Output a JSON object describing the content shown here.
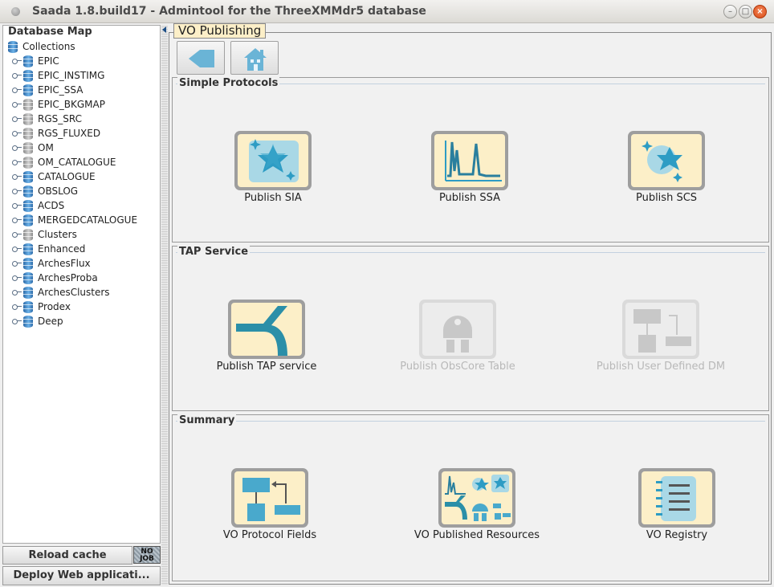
{
  "window": {
    "title": "Saada 1.8.build17 - Admintool for the ThreeXMMdr5 database",
    "buttons": {
      "minimize": "–",
      "maximize": "□",
      "close": "×"
    }
  },
  "sidebar": {
    "header": "Database Map",
    "root": "Collections",
    "items": [
      {
        "label": "EPIC",
        "color": "blue"
      },
      {
        "label": "EPIC_INSTIMG",
        "color": "blue"
      },
      {
        "label": "EPIC_SSA",
        "color": "blue"
      },
      {
        "label": "EPIC_BKGMAP",
        "color": "grey"
      },
      {
        "label": "RGS_SRC",
        "color": "grey"
      },
      {
        "label": "RGS_FLUXED",
        "color": "grey"
      },
      {
        "label": "OM",
        "color": "grey"
      },
      {
        "label": "OM_CATALOGUE",
        "color": "grey"
      },
      {
        "label": "CATALOGUE",
        "color": "blue"
      },
      {
        "label": "OBSLOG",
        "color": "blue"
      },
      {
        "label": "ACDS",
        "color": "blue"
      },
      {
        "label": "MERGEDCATALOGUE",
        "color": "blue"
      },
      {
        "label": "Clusters",
        "color": "grey"
      },
      {
        "label": "Enhanced",
        "color": "blue"
      },
      {
        "label": "ArchesFlux",
        "color": "blue"
      },
      {
        "label": "ArchesProba",
        "color": "blue"
      },
      {
        "label": "ArchesClusters",
        "color": "blue"
      },
      {
        "label": "Prodex",
        "color": "blue"
      },
      {
        "label": "Deep",
        "color": "blue"
      }
    ],
    "reload_label": "Reload cache",
    "job_badge": [
      "NO",
      "JOB"
    ],
    "deploy_label": "Deploy Web applicati..."
  },
  "main": {
    "tab_title": "VO Publishing",
    "sections": [
      {
        "title": "Simple Protocols",
        "tiles": [
          {
            "label": "Publish SIA",
            "icon": "sia-icon",
            "enabled": true
          },
          {
            "label": "Publish SSA",
            "icon": "ssa-icon",
            "enabled": true
          },
          {
            "label": "Publish SCS",
            "icon": "scs-icon",
            "enabled": true
          }
        ]
      },
      {
        "title": "TAP Service",
        "tiles": [
          {
            "label": "Publish TAP service",
            "icon": "tap-icon",
            "enabled": true
          },
          {
            "label": "Publish ObsCore Table",
            "icon": "obscore-icon",
            "enabled": false
          },
          {
            "label": "Publish User Defined DM",
            "icon": "user-dm-icon",
            "enabled": false
          }
        ]
      },
      {
        "title": "Summary",
        "tiles": [
          {
            "label": "VO Protocol Fields",
            "icon": "protocol-fields-icon",
            "enabled": true
          },
          {
            "label": "VO Published Resources",
            "icon": "published-resources-icon",
            "enabled": true
          },
          {
            "label": "VO Registry",
            "icon": "registry-icon",
            "enabled": true
          }
        ]
      }
    ]
  }
}
